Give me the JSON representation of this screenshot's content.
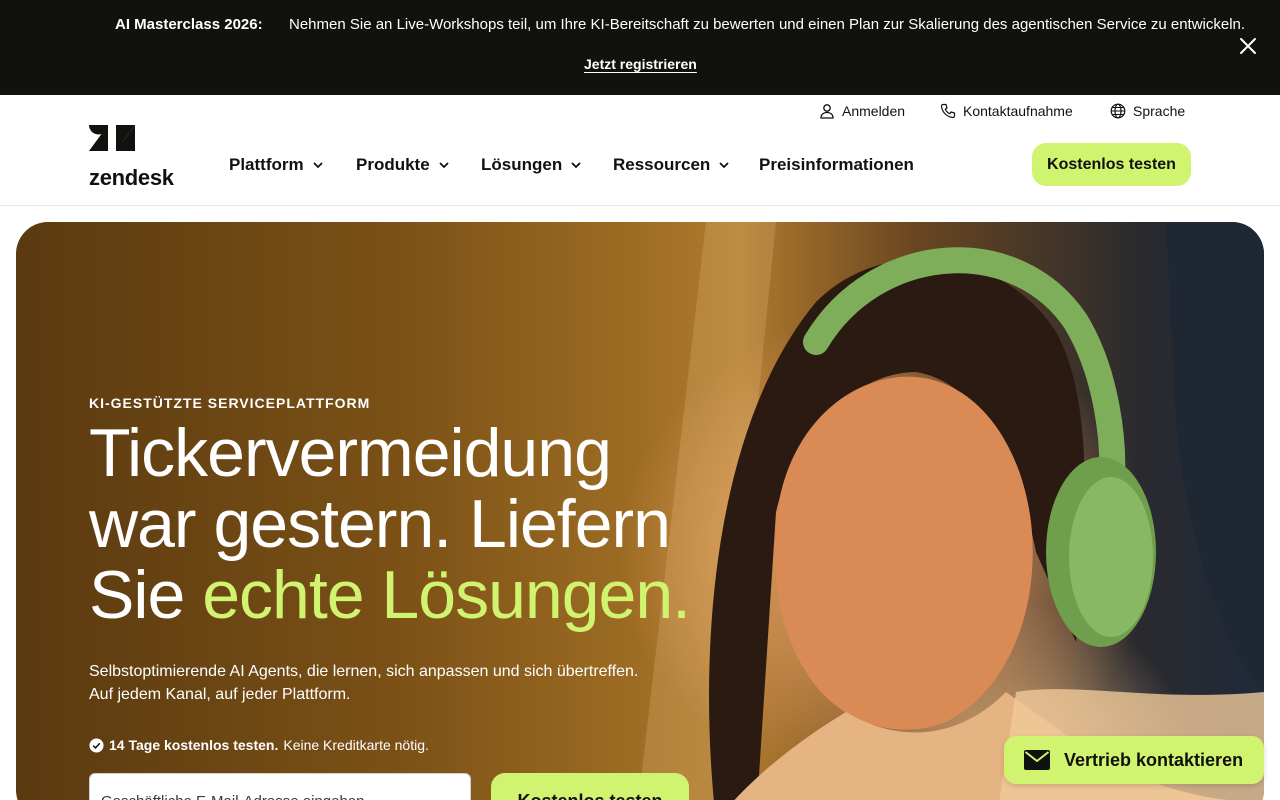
{
  "announcement": {
    "title": "AI Masterclass 2026:",
    "message": "Nehmen Sie an Live-Workshops teil, um Ihre KI-Bereitschaft zu bewerten und einen Plan zur Skalierung des agentischen Service zu entwickeln.",
    "link": "Jetzt registrieren",
    "close_icon": "close-icon"
  },
  "header": {
    "logo_text": "zendesk",
    "utility": {
      "login": "Anmelden",
      "contact": "Kontaktaufnahme",
      "language": "Sprache"
    },
    "nav": [
      {
        "label": "Plattform",
        "has_dropdown": true
      },
      {
        "label": "Produkte",
        "has_dropdown": true
      },
      {
        "label": "Lösungen",
        "has_dropdown": true
      },
      {
        "label": "Ressourcen",
        "has_dropdown": true
      },
      {
        "label": "Preisinformationen",
        "has_dropdown": false
      }
    ],
    "cta": "Kostenlos testen"
  },
  "hero": {
    "eyebrow": "KI-GESTÜTZTE SERVICEPLATTFORM",
    "headline_line1": "Tickervermeidung",
    "headline_line2": "war gestern. Liefern",
    "headline_line3_plain": "Sie ",
    "headline_line3_accent": "echte Lösungen.",
    "sub_line1": "Selbstoptimierende AI Agents, die lernen, sich anpassen und sich übertreffen.",
    "sub_line2": "Auf jedem Kanal, auf jeder Plattform.",
    "trial_bold": "14 Tage kostenlos testen.",
    "trial_rest": "Keine Kreditkarte nötig.",
    "email_placeholder": "Geschäftliche E-Mail-Adresse eingeben",
    "cta": "Kostenlos testen"
  },
  "contact_button": "Vertrieb kontaktieren",
  "colors": {
    "accent": "#d1f470",
    "dark": "#11110d"
  }
}
